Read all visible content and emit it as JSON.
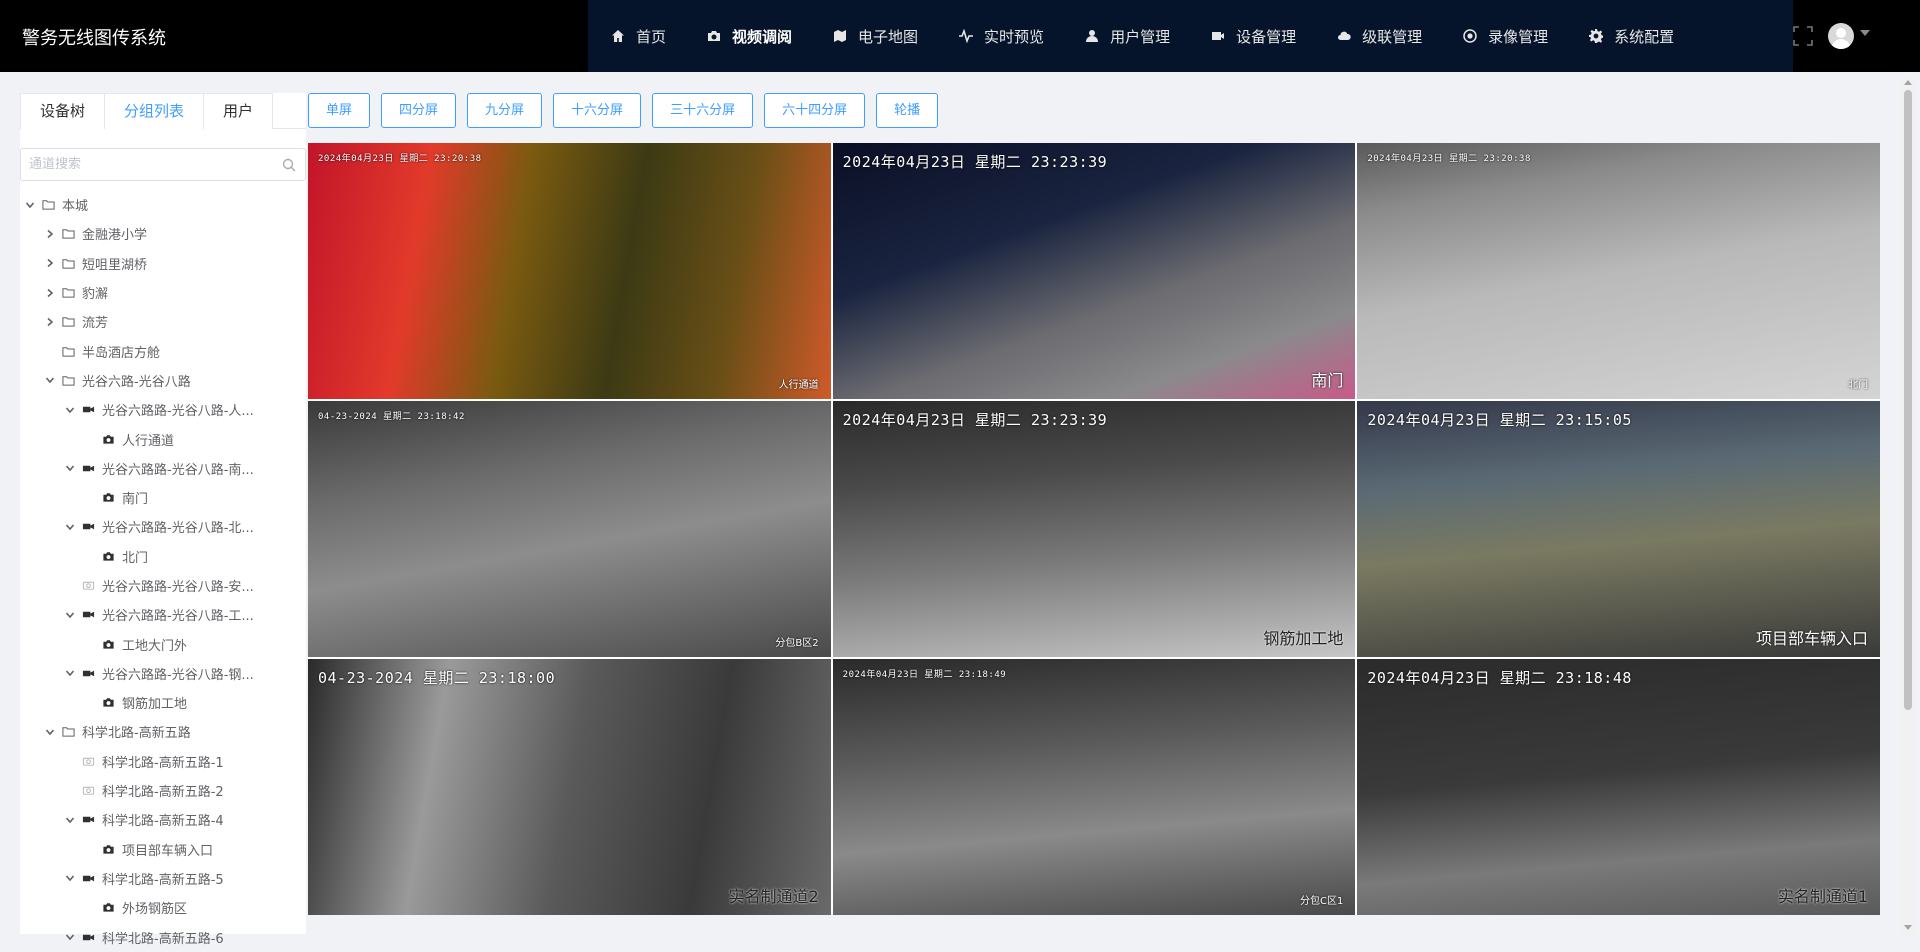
{
  "app": {
    "title": "警务无线图传系统"
  },
  "nav": {
    "items": [
      {
        "label": "首页",
        "icon": "home-icon"
      },
      {
        "label": "视频调阅",
        "icon": "camera-icon",
        "active": true
      },
      {
        "label": "电子地图",
        "icon": "map-icon"
      },
      {
        "label": "实时预览",
        "icon": "pulse-icon"
      },
      {
        "label": "用户管理",
        "icon": "user-icon"
      },
      {
        "label": "设备管理",
        "icon": "video-icon"
      },
      {
        "label": "级联管理",
        "icon": "cloud-icon"
      },
      {
        "label": "录像管理",
        "icon": "record-icon"
      },
      {
        "label": "系统配置",
        "icon": "gear-icon"
      }
    ]
  },
  "sidebar": {
    "tabs": [
      {
        "label": "设备树"
      },
      {
        "label": "分组列表",
        "active": true
      },
      {
        "label": "用户"
      }
    ],
    "search": {
      "placeholder": "通道搜索",
      "value": ""
    },
    "tree": [
      {
        "label": "本城",
        "level": 0,
        "type": "folder",
        "expanded": true
      },
      {
        "label": "金融港小学",
        "level": 1,
        "type": "folder",
        "expanded": false
      },
      {
        "label": "短咀里湖桥",
        "level": 1,
        "type": "folder",
        "expanded": false
      },
      {
        "label": "豹澥",
        "level": 1,
        "type": "folder",
        "expanded": false
      },
      {
        "label": "流芳",
        "level": 1,
        "type": "folder",
        "expanded": false
      },
      {
        "label": "半岛酒店方舱",
        "level": 1,
        "type": "folder",
        "leaf": true
      },
      {
        "label": "光谷六路-光谷八路",
        "level": 1,
        "type": "folder",
        "expanded": true
      },
      {
        "label": "光谷六路路-光谷八路-人...",
        "level": 2,
        "type": "device",
        "expanded": true
      },
      {
        "label": "人行通道",
        "level": 3,
        "type": "channel"
      },
      {
        "label": "光谷六路路-光谷八路-南...",
        "level": 2,
        "type": "device",
        "expanded": true
      },
      {
        "label": "南门",
        "level": 3,
        "type": "channel"
      },
      {
        "label": "光谷六路路-光谷八路-北...",
        "level": 2,
        "type": "device",
        "expanded": true
      },
      {
        "label": "北门",
        "level": 3,
        "type": "channel"
      },
      {
        "label": "光谷六路路-光谷八路-安...",
        "level": 2,
        "type": "device-offline",
        "leaf": true
      },
      {
        "label": "光谷六路路-光谷八路-工...",
        "level": 2,
        "type": "device",
        "expanded": true
      },
      {
        "label": "工地大门外",
        "level": 3,
        "type": "channel"
      },
      {
        "label": "光谷六路路-光谷八路-钢...",
        "level": 2,
        "type": "device",
        "expanded": true
      },
      {
        "label": "钢筋加工地",
        "level": 3,
        "type": "channel"
      },
      {
        "label": "科学北路-高新五路",
        "level": 1,
        "type": "folder",
        "expanded": true
      },
      {
        "label": "科学北路-高新五路-1",
        "level": 2,
        "type": "device-offline",
        "leaf": true
      },
      {
        "label": "科学北路-高新五路-2",
        "level": 2,
        "type": "device-offline",
        "leaf": true
      },
      {
        "label": "科学北路-高新五路-4",
        "level": 2,
        "type": "device",
        "expanded": true
      },
      {
        "label": "项目部车辆入口",
        "level": 3,
        "type": "channel"
      },
      {
        "label": "科学北路-高新五路-5",
        "level": 2,
        "type": "device",
        "expanded": true
      },
      {
        "label": "外场钢筋区",
        "level": 3,
        "type": "channel"
      },
      {
        "label": "科学北路-高新五路-6",
        "level": 2,
        "type": "device",
        "expanded": true
      }
    ]
  },
  "split_buttons": [
    "单屏",
    "四分屏",
    "九分屏",
    "十六分屏",
    "三十六分屏",
    "六十四分屏",
    "轮播"
  ],
  "videos": [
    {
      "timestamp": "2024年04月23日 星期二 23:20:38",
      "label": "人行通道",
      "ts_size": "small",
      "lbl_size": "small",
      "scene": "red"
    },
    {
      "timestamp": "2024年04月23日 星期二 23:23:39",
      "label": "南门",
      "ts_size": "big",
      "lbl_size": "big",
      "scene": "color-night"
    },
    {
      "timestamp": "2024年04月23日 星期二 23:20:38",
      "label": "北门",
      "ts_size": "small",
      "lbl_size": "small",
      "scene": "gray-light"
    },
    {
      "timestamp": "04-23-2024 星期二 23:18:42",
      "label": "分包B区2",
      "ts_size": "small",
      "lbl_size": "small",
      "scene": "gray-dark"
    },
    {
      "timestamp": "2024年04月23日 星期二 23:23:39",
      "label": "钢筋加工地",
      "ts_size": "big",
      "lbl_size": "big",
      "scene": "gray-mid",
      "lbl_dark": true
    },
    {
      "timestamp": "2024年04月23日 星期二 23:15:05",
      "label": "项目部车辆入口",
      "ts_size": "big",
      "lbl_size": "big",
      "scene": "color-site"
    },
    {
      "timestamp": "04-23-2024 星期二 23:18:00",
      "label": "实名制通道2",
      "ts_size": "big",
      "lbl_size": "big",
      "scene": "gray-gate",
      "lbl_dark": true
    },
    {
      "timestamp": "2024年04月23日 星期二 23:18:49",
      "label": "分包C区1",
      "ts_size": "small",
      "lbl_size": "small",
      "scene": "gray-cars"
    },
    {
      "timestamp": "2024年04月23日 星期二 23:18:48",
      "label": "实名制通道1",
      "ts_size": "big",
      "lbl_size": "big",
      "scene": "gray-night",
      "lbl_dark": true
    }
  ],
  "colors": {
    "accent": "#409eff",
    "header_bg": "#000000",
    "nav_bg": "#06142b"
  }
}
